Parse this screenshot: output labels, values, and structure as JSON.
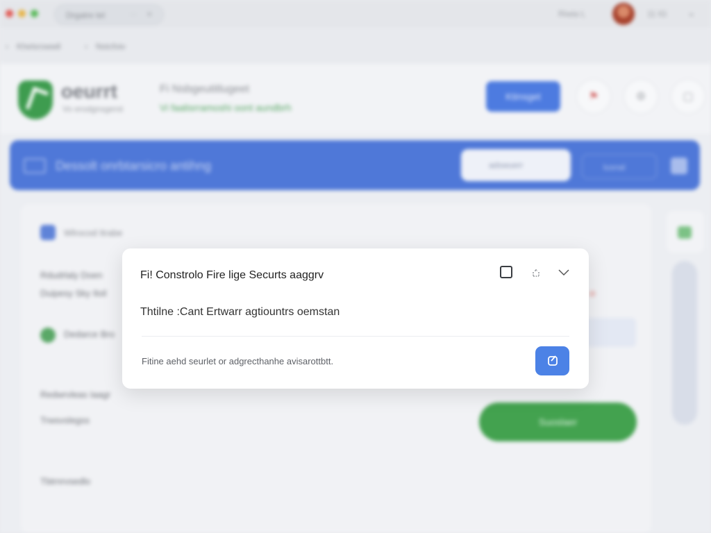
{
  "window": {
    "tab_label": "Drgatre tel",
    "user_name": "Riwia L",
    "clock": "11 IG"
  },
  "breadcrumb": {
    "item_1": "Khelsrowwll",
    "item_2": "Nstcfoiv"
  },
  "header": {
    "brand_name": "oeurrt",
    "brand_tagline": "Vo erodgnsgerst",
    "title": "Fi Nsbgeutitlugeet",
    "link": "Vi faalisrramoshi oont aundbrh"
  },
  "toolbar": {
    "primary_label": "Ktinsget"
  },
  "banner": {
    "title": "Dessolt onrbtarsicro antihng",
    "search_placeholder": "adswuerr",
    "outline_label": "lusnal"
  },
  "card": {
    "section_title": "Wlrocod Itrabe",
    "row_1": "Rdudrlaly Doen",
    "row_2": "Duipesy Sky Iloil",
    "row_3": "Dedarce Bro",
    "row_4": "Redwrvleas Iaagr",
    "row_5": "Trwsvslegss",
    "row_6": "Tbtrnrvsedlo",
    "green_button": "Suoslaer"
  },
  "dialog": {
    "title": "Fi!  Constrolo  Fire lige Securts aaggrv",
    "body": "Thtilne :Cant Ertwarr agtiountrs oemstan",
    "footer": "Fitine aehd seurlet or adgrecthanhe avisarottbtt."
  },
  "colors": {
    "accent": "#4c82e6",
    "brand_green": "#43a24f",
    "banner": "#4f78d8"
  }
}
